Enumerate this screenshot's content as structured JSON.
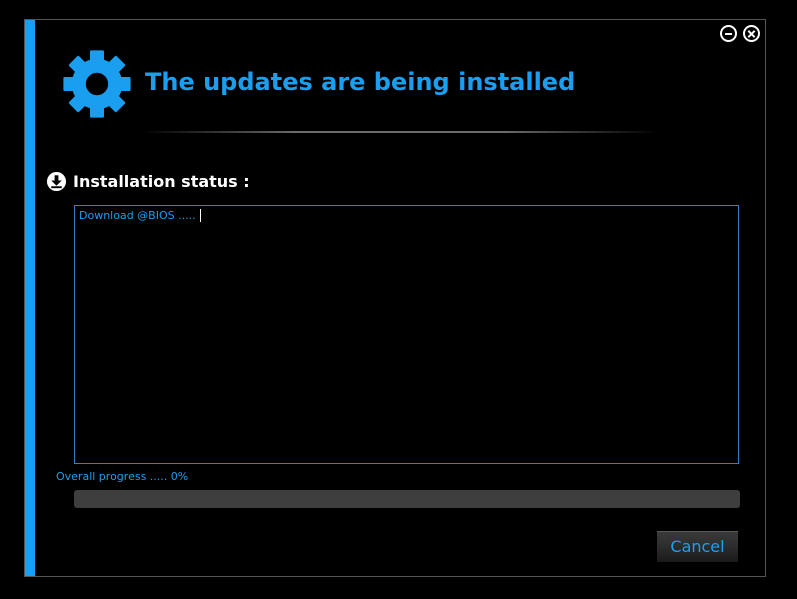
{
  "window": {
    "title": "The updates are being installed",
    "accent_color": "#1a9ff0",
    "controls": {
      "minimize_icon": "minimize-circle-icon",
      "close_icon": "close-circle-icon"
    },
    "header_icon": "gear-icon"
  },
  "status": {
    "icon": "download-icon",
    "label": "Installation status :",
    "log_lines": [
      "Download @BIOS ....."
    ]
  },
  "progress": {
    "label": "Overall progress ..... 0%",
    "percent": 0
  },
  "footer": {
    "cancel_label": "Cancel"
  }
}
